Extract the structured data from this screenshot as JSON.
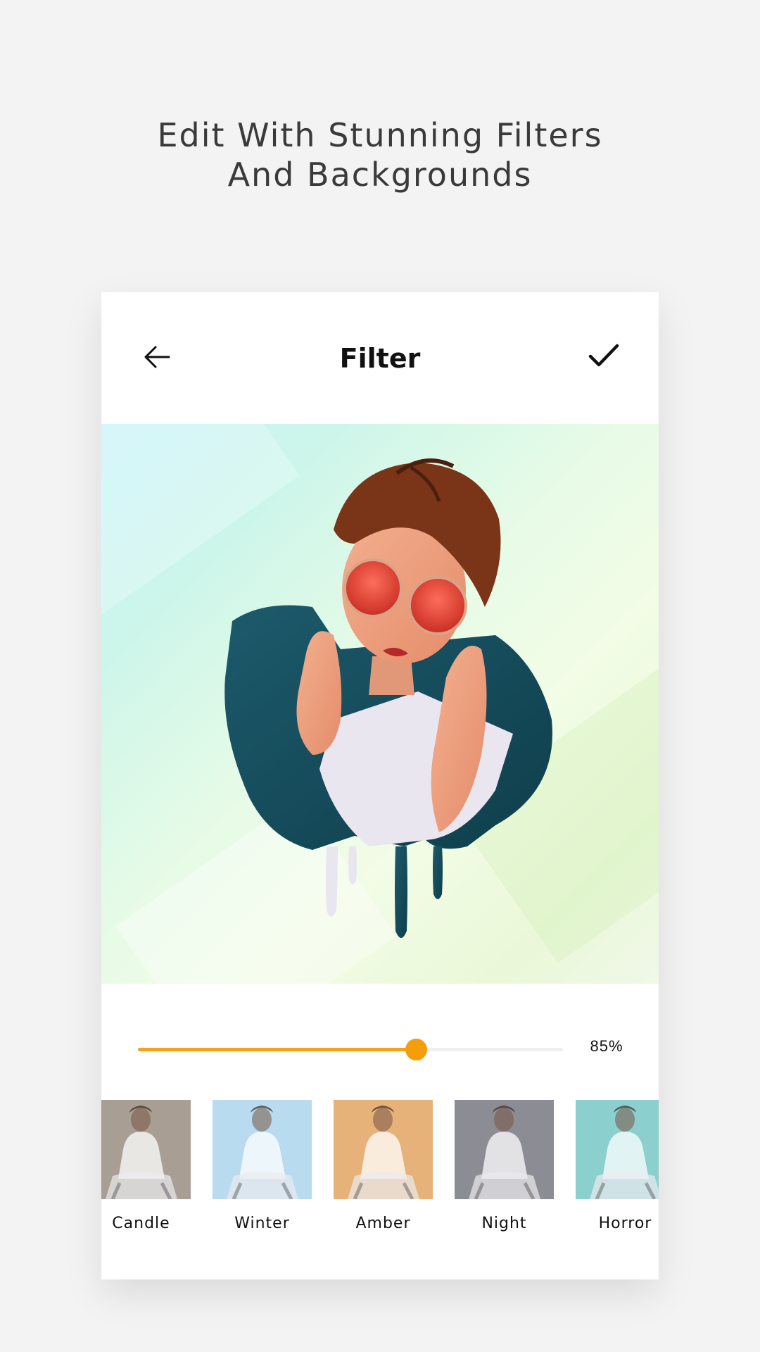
{
  "promo": {
    "line1": "Edit With Stunning Filters",
    "line2": "And Backgrounds"
  },
  "toolbar": {
    "title": "Filter",
    "back_icon": "arrow-left-icon",
    "confirm_icon": "checkmark-icon"
  },
  "editor": {
    "intensity_label": "85%",
    "intensity": 0.85,
    "accent_color": "#f59e0b"
  },
  "filters": [
    {
      "label": "Candle",
      "tint": "#a89e94"
    },
    {
      "label": "Winter",
      "tint": "#b8dbef"
    },
    {
      "label": "Amber",
      "tint": "#e7b27a"
    },
    {
      "label": "Night",
      "tint": "#8c8c94"
    },
    {
      "label": "Horror",
      "tint": "#8ccfcf"
    }
  ]
}
